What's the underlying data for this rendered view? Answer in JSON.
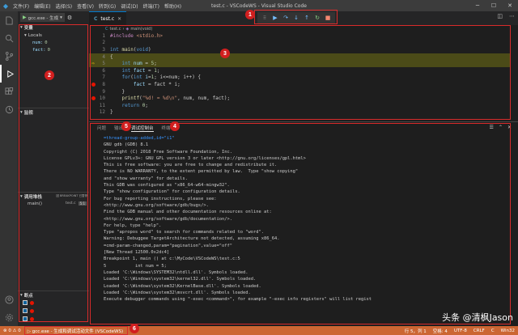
{
  "titlebar": {
    "menus": [
      "文件(F)",
      "编辑(E)",
      "选择(S)",
      "查看(V)",
      "转到(G)",
      "调试(D)",
      "终端(T)",
      "帮助(H)"
    ],
    "title": "test.c - VSCodeWS - Visual Studio Code"
  },
  "sidebar": {
    "config": "gcc.exe - 生成",
    "vars_header": "变量",
    "locals_header": "Locals",
    "vars": [
      {
        "name": "num:",
        "value": "0"
      },
      {
        "name": "fact:",
        "value": "0"
      }
    ],
    "watch_header": "监视",
    "callstack_header": "调用堆栈",
    "callstack_status": "因 BREAKPOINT 已暂停",
    "frame_name": "main()",
    "frame_file": "test.c",
    "frame_line": "5:1",
    "breakpoints_header": "断点"
  },
  "tab": {
    "label": "test.c"
  },
  "breadcrumb": {
    "file": "test.c",
    "fn": "main(void)"
  },
  "editor": {
    "lines": [
      {
        "n": "1",
        "segs": [
          [
            "pp",
            "#include "
          ],
          [
            "inc",
            "<stdio.h>"
          ]
        ]
      },
      {
        "n": "2",
        "segs": []
      },
      {
        "n": "3",
        "segs": [
          [
            "ty",
            "int "
          ],
          [
            "fn",
            "main"
          ],
          [
            "",
            "("
          ],
          [
            "ty",
            "void"
          ],
          [
            "",
            ")"
          ]
        ]
      },
      {
        "n": "4",
        "segs": [
          [
            "",
            "{"
          ]
        ]
      },
      {
        "n": "5",
        "segs": [
          [
            "",
            "    "
          ],
          [
            "ty",
            "int "
          ],
          [
            "vr",
            "num"
          ],
          [
            "",
            " = "
          ],
          [
            "num",
            "5"
          ],
          [
            "",
            ";"
          ]
        ]
      },
      {
        "n": "6",
        "segs": [
          [
            "",
            "    "
          ],
          [
            "ty",
            "int "
          ],
          [
            "vr",
            "fact"
          ],
          [
            "",
            " = "
          ],
          [
            "num",
            "1"
          ],
          [
            "",
            ";"
          ]
        ]
      },
      {
        "n": "7",
        "segs": [
          [
            "",
            "    "
          ],
          [
            "kw",
            "for"
          ],
          [
            "",
            "("
          ],
          [
            "ty",
            "int "
          ],
          [
            "vr",
            "i"
          ],
          [
            "",
            "="
          ],
          [
            "num",
            "1"
          ],
          [
            "",
            "; i<=num; i++) {"
          ]
        ]
      },
      {
        "n": "8",
        "segs": [
          [
            "",
            "        "
          ],
          [
            "vr",
            "fact"
          ],
          [
            "",
            " = fact * i;"
          ]
        ]
      },
      {
        "n": "9",
        "segs": [
          [
            "",
            "    }"
          ]
        ]
      },
      {
        "n": "10",
        "segs": [
          [
            "",
            "    "
          ],
          [
            "fn",
            "printf"
          ],
          [
            "",
            "("
          ],
          [
            "str",
            "\"%d! = %d\\n\""
          ],
          [
            "",
            ", num, num, fact);"
          ]
        ]
      },
      {
        "n": "11",
        "segs": [
          [
            "",
            "    "
          ],
          [
            "kw",
            "return "
          ],
          [
            "num",
            "0"
          ],
          [
            "",
            ";"
          ]
        ]
      },
      {
        "n": "12",
        "segs": [
          [
            "",
            "}"
          ]
        ]
      }
    ]
  },
  "panel": {
    "tabs": [
      "问题",
      "输出",
      "调试控制台",
      "终端"
    ],
    "active": 2
  },
  "console": [
    "=thread-group-added,id=\"i1\"",
    "GNU gdb (GDB) 8.1",
    "Copyright (C) 2018 Free Software Foundation, Inc.",
    "License GPLv3+: GNU GPL version 3 or later <http://gnu.org/licenses/gpl.html>",
    "This is free software: you are free to change and redistribute it.",
    "There is NO WARRANTY, to the extent permitted by law.  Type \"show copying\"",
    "and \"show warranty\" for details.",
    "This GDB was configured as \"x86_64-w64-mingw32\".",
    "Type \"show configuration\" for configuration details.",
    "For bug reporting instructions, please see:",
    "<http://www.gnu.org/software/gdb/bugs/>.",
    "Find the GDB manual and other documentation resources online at:",
    "<http://www.gnu.org/software/gdb/documentation/>.",
    "For help, type \"help\".",
    "Type \"apropos word\" to search for commands related to \"word\".",
    "Warning: Debuggee TargetArchitecture not detected, assuming x86_64.",
    "=cmd-param-changed,param=\"pagination\",value=\"off\"",
    "[New Thread 12500.0x2dc4]",
    "",
    "Breakpoint 1, main () at c:\\MyCode\\VSCodeWS\\test.c:5",
    "5           int num = 5;",
    "Loaded 'C:\\Windows\\SYSTEM32\\ntdll.dll'. Symbols loaded.",
    "Loaded 'C:\\Windows\\system32\\kernel32.dll'. Symbols loaded.",
    "Loaded 'C:\\Windows\\system32\\KernelBase.dll'. Symbols loaded.",
    "Loaded 'C:\\Windows\\system32\\msvcrt.dll'. Symbols loaded.",
    "Execute debugger commands using \"-exec <command>\", for example \"-exec info registers\" will list regist"
  ],
  "statusbar": {
    "left": [
      "⊗ 0  ⚠ 0",
      "▷ gcc.exe - 生成和调试活动文件 (VSCodeWS)"
    ],
    "right": [
      "行 5，列 1",
      "空格: 4",
      "UTF-8",
      "CRLF",
      "C",
      "Win32"
    ]
  },
  "badges": [
    "1",
    "2",
    "3",
    "4",
    "5",
    "6"
  ],
  "watermark": "头条 @清枫Jason"
}
